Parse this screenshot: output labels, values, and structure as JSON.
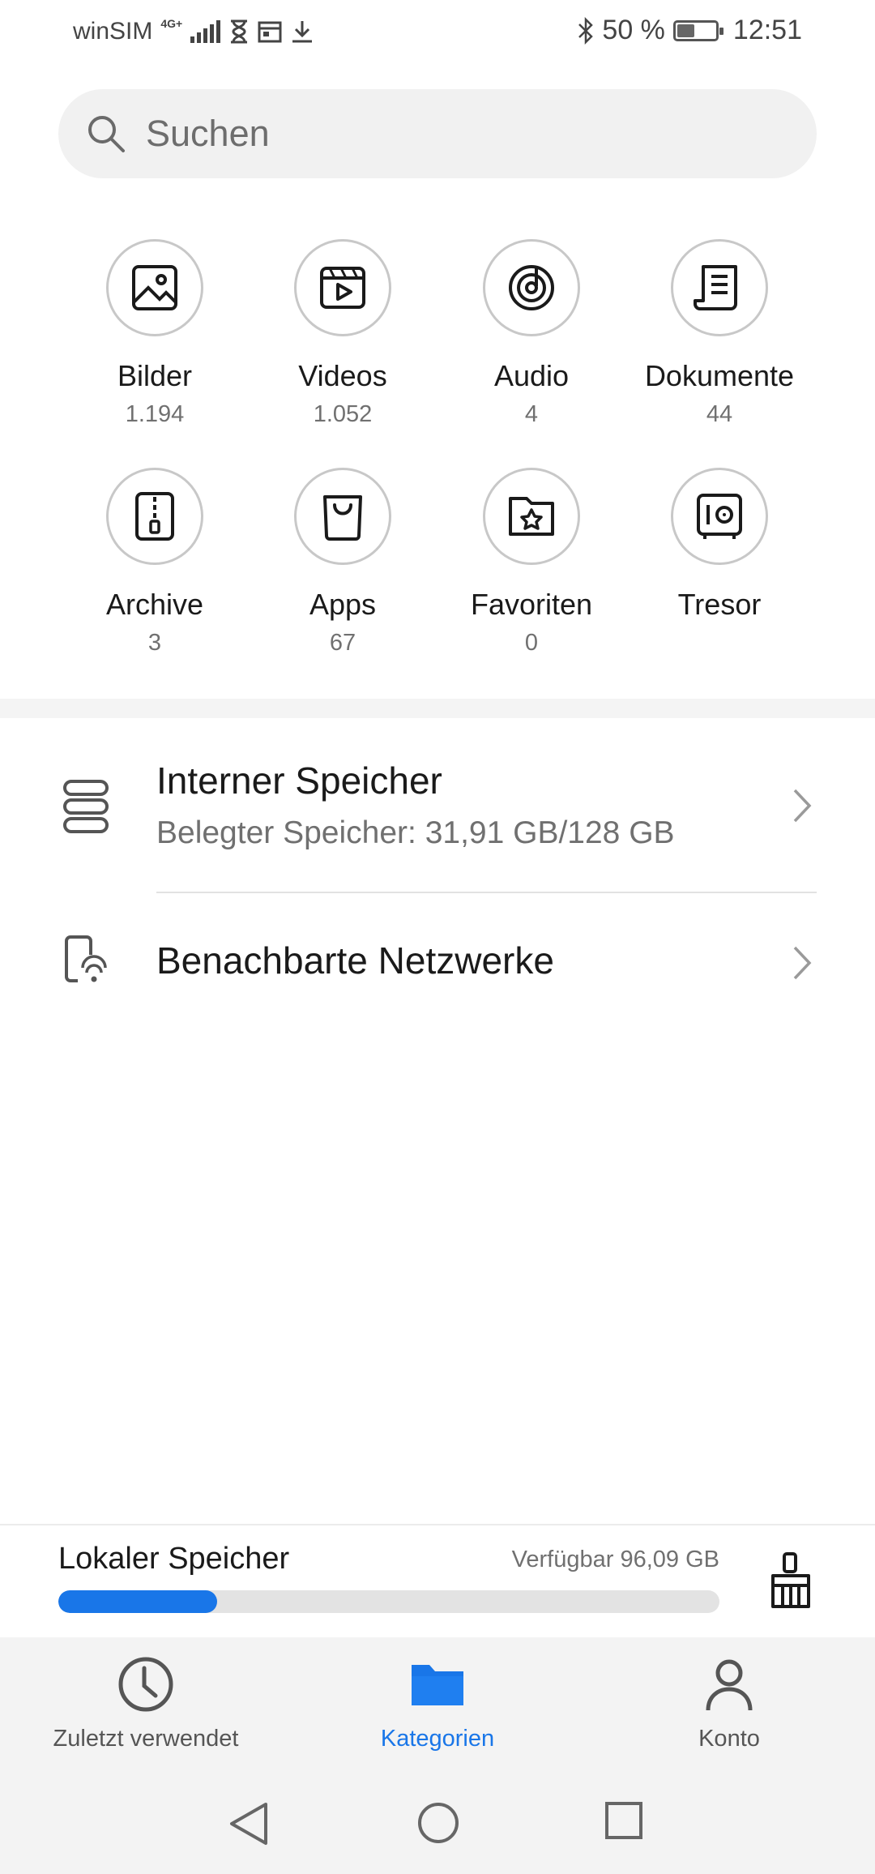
{
  "status_bar": {
    "carrier": "winSIM",
    "network": "4G+",
    "battery": "50 %",
    "battery_level": 0.5,
    "time": "12:51"
  },
  "search": {
    "placeholder": "Suchen"
  },
  "categories": [
    {
      "label": "Bilder",
      "count": "1.194",
      "icon": "image-icon"
    },
    {
      "label": "Videos",
      "count": "1.052",
      "icon": "video-icon"
    },
    {
      "label": "Audio",
      "count": "4",
      "icon": "audio-icon"
    },
    {
      "label": "Dokumente",
      "count": "44",
      "icon": "document-icon"
    },
    {
      "label": "Archive",
      "count": "3",
      "icon": "archive-icon"
    },
    {
      "label": "Apps",
      "count": "67",
      "icon": "apps-bag-icon"
    },
    {
      "label": "Favoriten",
      "count": "0",
      "icon": "favorites-icon"
    },
    {
      "label": "Tresor",
      "count": "",
      "icon": "safe-icon"
    }
  ],
  "storage_list": {
    "internal": {
      "title": "Interner Speicher",
      "subtitle": "Belegter Speicher: 31,91 GB/128 GB",
      "icon": "storage-icon"
    },
    "nearby": {
      "title": "Benachbarte Netzwerke",
      "icon": "nearby-network-icon"
    }
  },
  "local_storage": {
    "title": "Lokaler Speicher",
    "available": "Verfügbar 96,09 GB",
    "used_fraction": 0.24,
    "icon": "clean-broom-icon"
  },
  "bottom_nav": [
    {
      "label": "Zuletzt verwendet",
      "icon": "clock-icon",
      "active": false
    },
    {
      "label": "Kategorien",
      "icon": "folder-icon",
      "active": true
    },
    {
      "label": "Konto",
      "icon": "account-icon",
      "active": false
    }
  ],
  "colors": {
    "accent": "#1976e8",
    "text": "#1a1a1a",
    "secondary_text": "#707070"
  }
}
